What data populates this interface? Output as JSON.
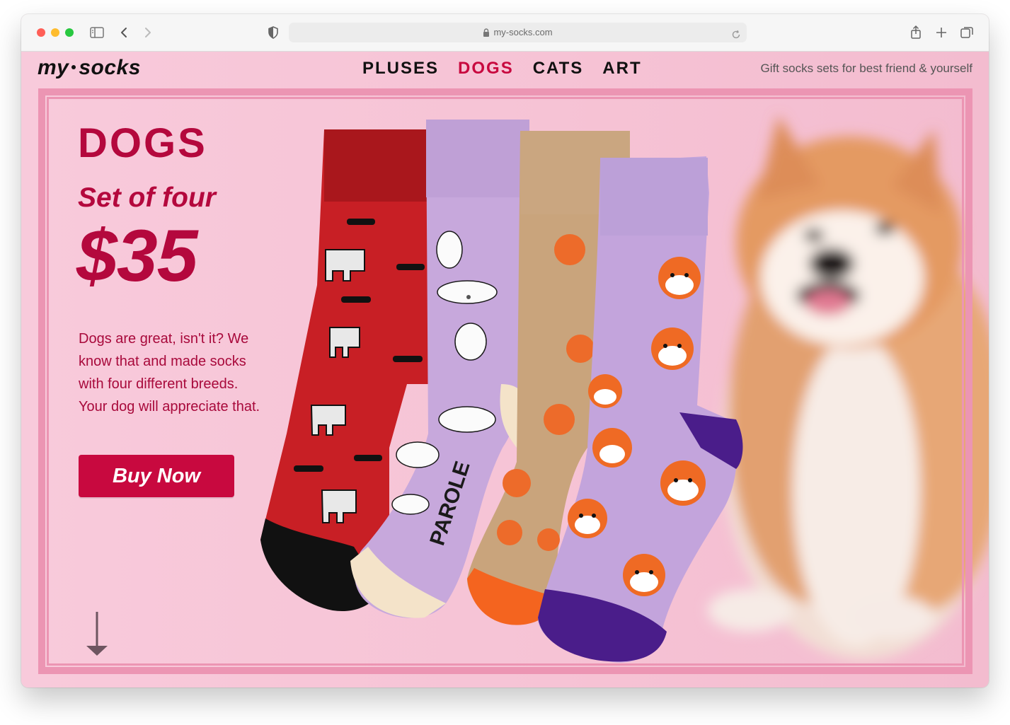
{
  "browser": {
    "url": "my-socks.com"
  },
  "site": {
    "logo_left": "my",
    "logo_right": "socks",
    "nav": [
      {
        "label": "PLUSES"
      },
      {
        "label": "DOGS",
        "active": true
      },
      {
        "label": "CATS"
      },
      {
        "label": "ART"
      }
    ],
    "tagline": "Gift socks sets for best friend & yourself"
  },
  "hero": {
    "title": "DOGS",
    "subtitle": "Set of four",
    "price": "$35",
    "description": "Dogs are great, isn't it? We know that and made socks with four different breeds. Your dog will appreciate that.",
    "cta": "Buy Now",
    "sock_print": "PAROLE"
  },
  "colors": {
    "accent": "#c8093f",
    "title": "#b4083d",
    "page_bg": "#f6c3d5",
    "frame": "#ec95b3"
  },
  "icons": [
    "sidebar-icon",
    "back-icon",
    "forward-icon",
    "shield-icon",
    "lock-icon",
    "reload-icon",
    "share-icon",
    "new-tab-icon",
    "tabs-icon",
    "scroll-down-arrow-icon"
  ]
}
